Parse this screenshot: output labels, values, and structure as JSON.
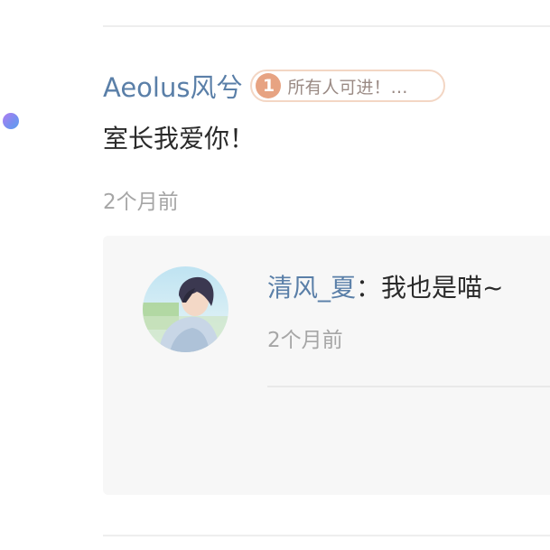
{
  "comment": {
    "author": "Aeolus风兮",
    "badge": {
      "level": "1",
      "text": "所有人可进！…"
    },
    "text": "室长我爱你！",
    "time": "2个月前"
  },
  "reply": {
    "author": "清风_夏",
    "separator": "：",
    "text": "我也是喵~",
    "time": "2个月前"
  },
  "colors": {
    "author_name": "#5a7fa8",
    "badge_border": "#f3d6c4",
    "badge_level_bg": "#e7a382",
    "meta_text": "#a6a6a6",
    "reply_bg": "#f7f7f7"
  }
}
